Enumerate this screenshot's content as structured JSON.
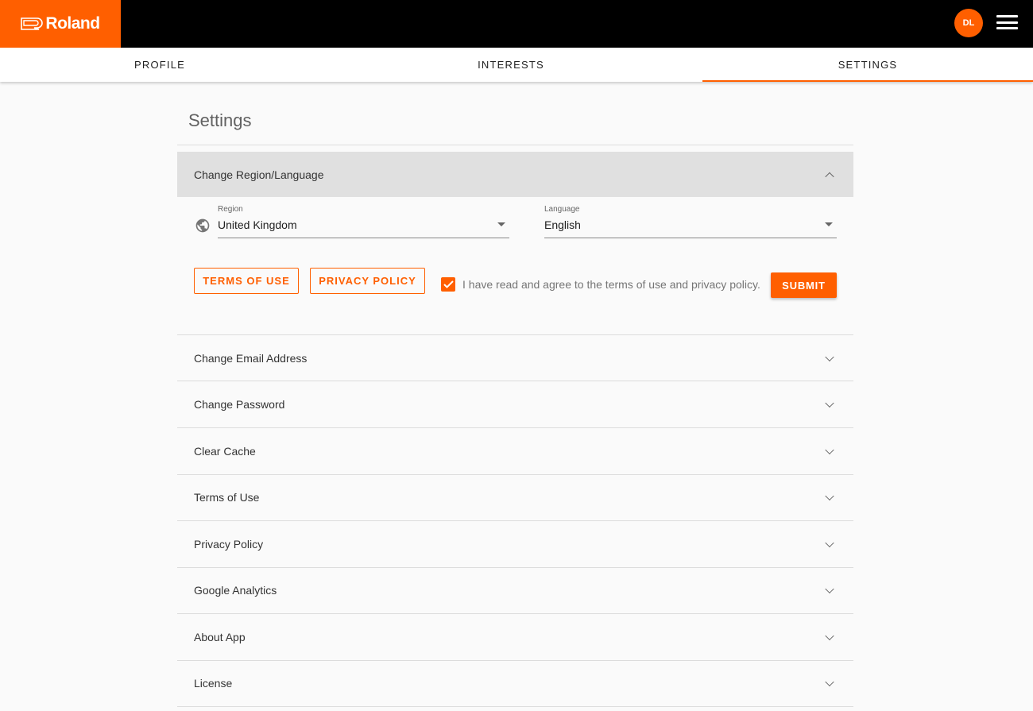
{
  "header": {
    "brand": "Roland",
    "avatar_initials": "DL"
  },
  "tabs": [
    {
      "label": "PROFILE"
    },
    {
      "label": "INTERESTS"
    },
    {
      "label": "SETTINGS",
      "active": true
    }
  ],
  "page": {
    "title": "Settings"
  },
  "region_panel": {
    "title": "Change Region/Language",
    "region_label": "Region",
    "region_value": "United Kingdom",
    "language_label": "Language",
    "language_value": "English",
    "terms_button": "TERMS OF USE",
    "privacy_button": "PRIVACY POLICY",
    "agree_checked": true,
    "agree_text": "I have read and agree to the terms of use and privacy policy.",
    "submit_label": "SUBMIT"
  },
  "sections": [
    {
      "title": "Change Email Address"
    },
    {
      "title": "Change Password"
    },
    {
      "title": "Clear Cache"
    },
    {
      "title": "Terms of Use"
    },
    {
      "title": "Privacy Policy"
    },
    {
      "title": "Google Analytics"
    },
    {
      "title": "About App"
    },
    {
      "title": "License"
    }
  ],
  "colors": {
    "accent": "#ff5f00",
    "topbar": "#000000",
    "background": "#fafafa"
  }
}
